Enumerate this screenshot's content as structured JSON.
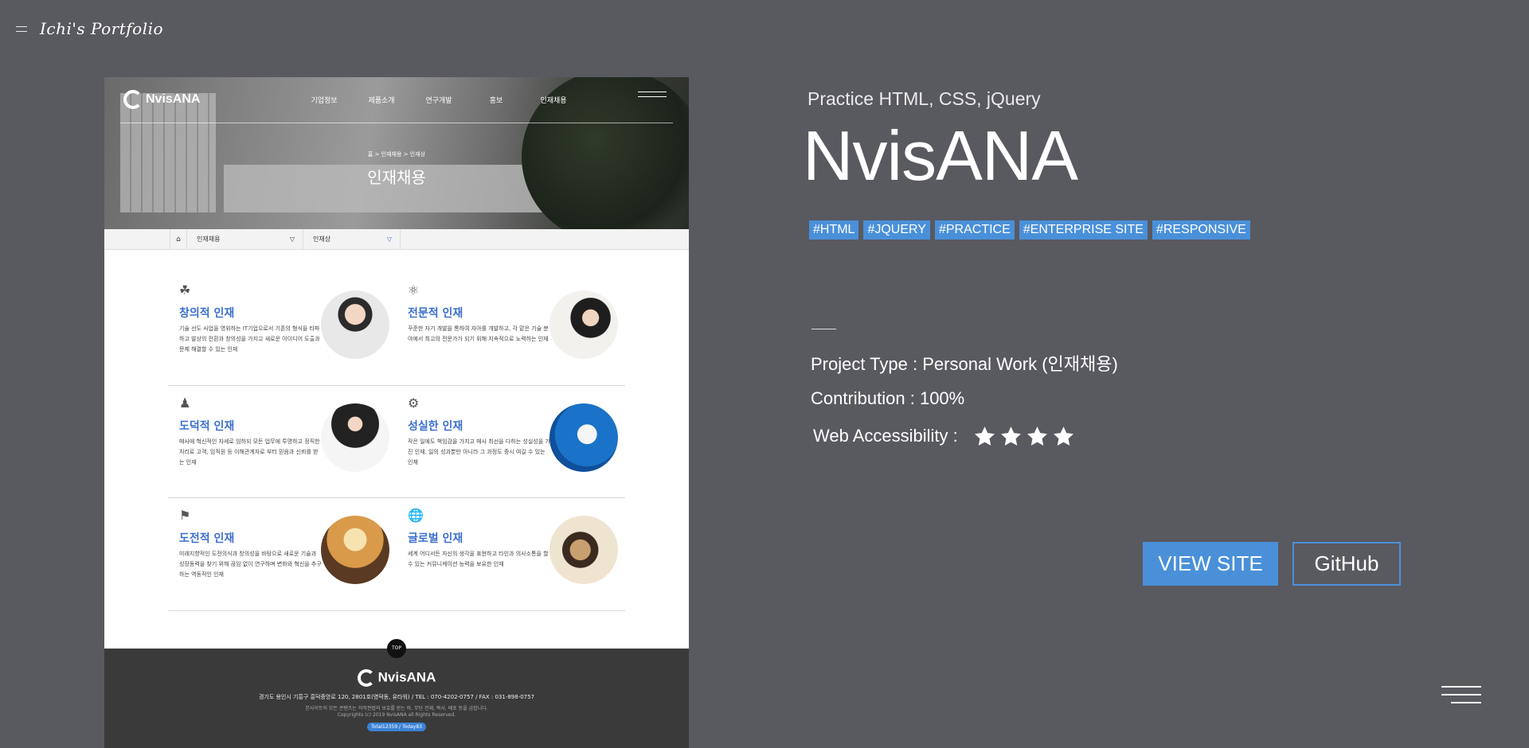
{
  "header": {
    "logo_text": "Ichi's Portfolio"
  },
  "preview": {
    "nav_logo": "NvisANA",
    "nav_items": [
      "기업정보",
      "제품소개",
      "연구개발",
      "홍보",
      "인재채용"
    ],
    "breadcrumb": "홈 > 인재채용 > 인재상",
    "hero_title": "인재채용",
    "select_1": "인재채용",
    "select_2": "인재상",
    "cards": [
      {
        "title": "창의적 인재",
        "text": "기술 선도 사업을 영위하는 IT기업으로서 기존의 형식을 타파하고 발상의 전환과 창의성을 가지고 새로운 아이디어 도출과 문제 해결할 수 있는 인재"
      },
      {
        "title": "전문적 인재",
        "text": "꾸준한 자기 개발을 통하여 자아를 개발하고, 각 맡은 기술 분야에서 최고의 전문가가 되기 위해 지속적으로 노력하는 인재"
      },
      {
        "title": "도덕적 인재",
        "text": "매사에 혁신적인 자세로 임하되 모든 업무에 투명하고 정직한 처리로 고객, 임직원 등 이해관계자로 부터 믿음과 신뢰를 받는 인재"
      },
      {
        "title": "성실한 인재",
        "text": "작은 일에도 책임감을 가지고 매사 최선을 다하는 성실성을 가진 인재. 일의 성과뿐만 아니라 그 과정도 중시 여길 수 있는 인재"
      },
      {
        "title": "도전적 인재",
        "text": "미래지향적인 도전의식과 창의성을 바탕으로 새로운 기술과 성장동력을 찾기 위해 끊임 없이 연구하며 변화와 혁신을 추구하는 역동적인 인재"
      },
      {
        "title": "글로벌 인재",
        "text": "세계 어디서든 자신의 생각을 표현하고 타인과 의사소통을 할 수 있는 커뮤니케이션 능력을 보유한 인재"
      }
    ],
    "top_button": "TOP",
    "footer_logo": "NvisANA",
    "footer_address": "경기도 용인시 기흥구 흥덕중앙로 120, 2801호(영덕동, 유타워)   /   TEL : 070-4202-0757   /   FAX : 031-898-0757",
    "footer_notice": "본사이트의 모든 콘텐츠는 저작권법의 보호를 받는 바, 무단 전재, 복사, 배포 등을 금합니다.",
    "footer_copyright": "Copyrights (c) 2019 NvisANA all Rights Reserved.",
    "footer_counter": "Total12359 / Today83"
  },
  "info": {
    "subtitle": "Practice HTML, CSS, jQuery",
    "title": "NvisANA",
    "tags": [
      "#HTML",
      "#JQUERY",
      "#PRACTICE",
      "#ENTERPRISE SITE",
      "#RESPONSIVE"
    ],
    "project_type": "Project Type : Personal Work (인재채용)",
    "contribution": "Contribution : 100%",
    "accessibility_label": "Web Accessibility :",
    "accessibility_stars": 4,
    "view_site": "VIEW SITE",
    "github": "GitHub"
  },
  "colors": {
    "background": "#595960",
    "accent": "#4a90d9"
  }
}
